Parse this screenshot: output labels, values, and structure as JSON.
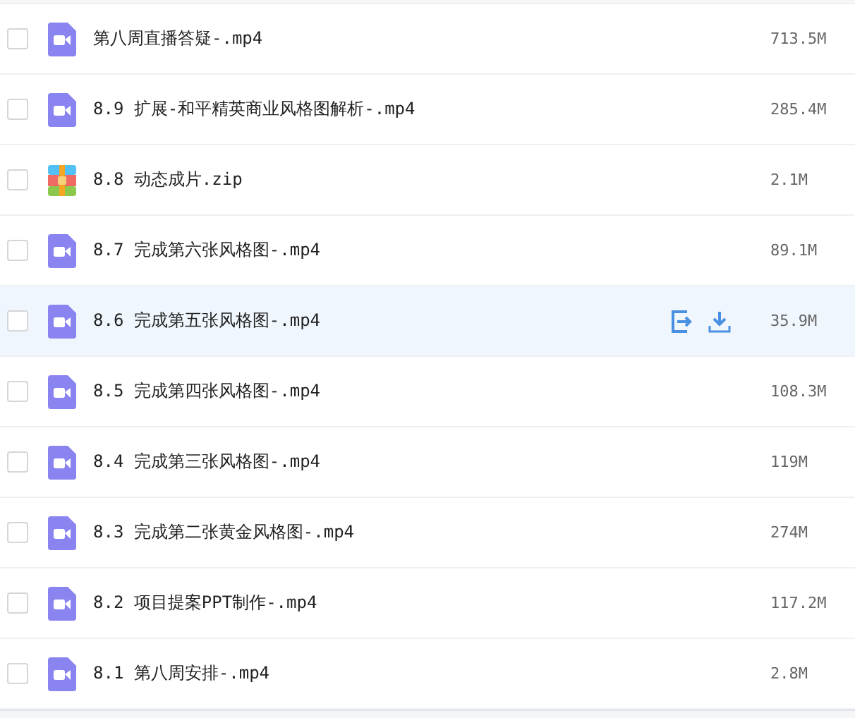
{
  "files": [
    {
      "name": "第八周直播答疑-.mp4",
      "size": "713.5M",
      "kind": "video",
      "checked": false,
      "highlighted": false
    },
    {
      "name": "8.9 扩展-和平精英商业风格图解析-.mp4",
      "size": "285.4M",
      "kind": "video",
      "checked": false,
      "highlighted": false
    },
    {
      "name": "8.8 动态成片.zip",
      "size": "2.1M",
      "kind": "zip",
      "checked": false,
      "highlighted": false
    },
    {
      "name": "8.7 完成第六张风格图-.mp4",
      "size": "89.1M",
      "kind": "video",
      "checked": false,
      "highlighted": false
    },
    {
      "name": "8.6 完成第五张风格图-.mp4",
      "size": "35.9M",
      "kind": "video",
      "checked": false,
      "highlighted": true
    },
    {
      "name": "8.5 完成第四张风格图-.mp4",
      "size": "108.3M",
      "kind": "video",
      "checked": false,
      "highlighted": false
    },
    {
      "name": "8.4 完成第三张风格图-.mp4",
      "size": "119M",
      "kind": "video",
      "checked": false,
      "highlighted": false
    },
    {
      "name": "8.3 完成第二张黄金风格图-.mp4",
      "size": "274M",
      "kind": "video",
      "checked": false,
      "highlighted": false
    },
    {
      "name": "8.2 项目提案PPT制作-.mp4",
      "size": "117.2M",
      "kind": "video",
      "checked": false,
      "highlighted": false
    },
    {
      "name": "8.1 第八周安排-.mp4",
      "size": "2.8M",
      "kind": "video",
      "checked": false,
      "highlighted": false
    }
  ]
}
